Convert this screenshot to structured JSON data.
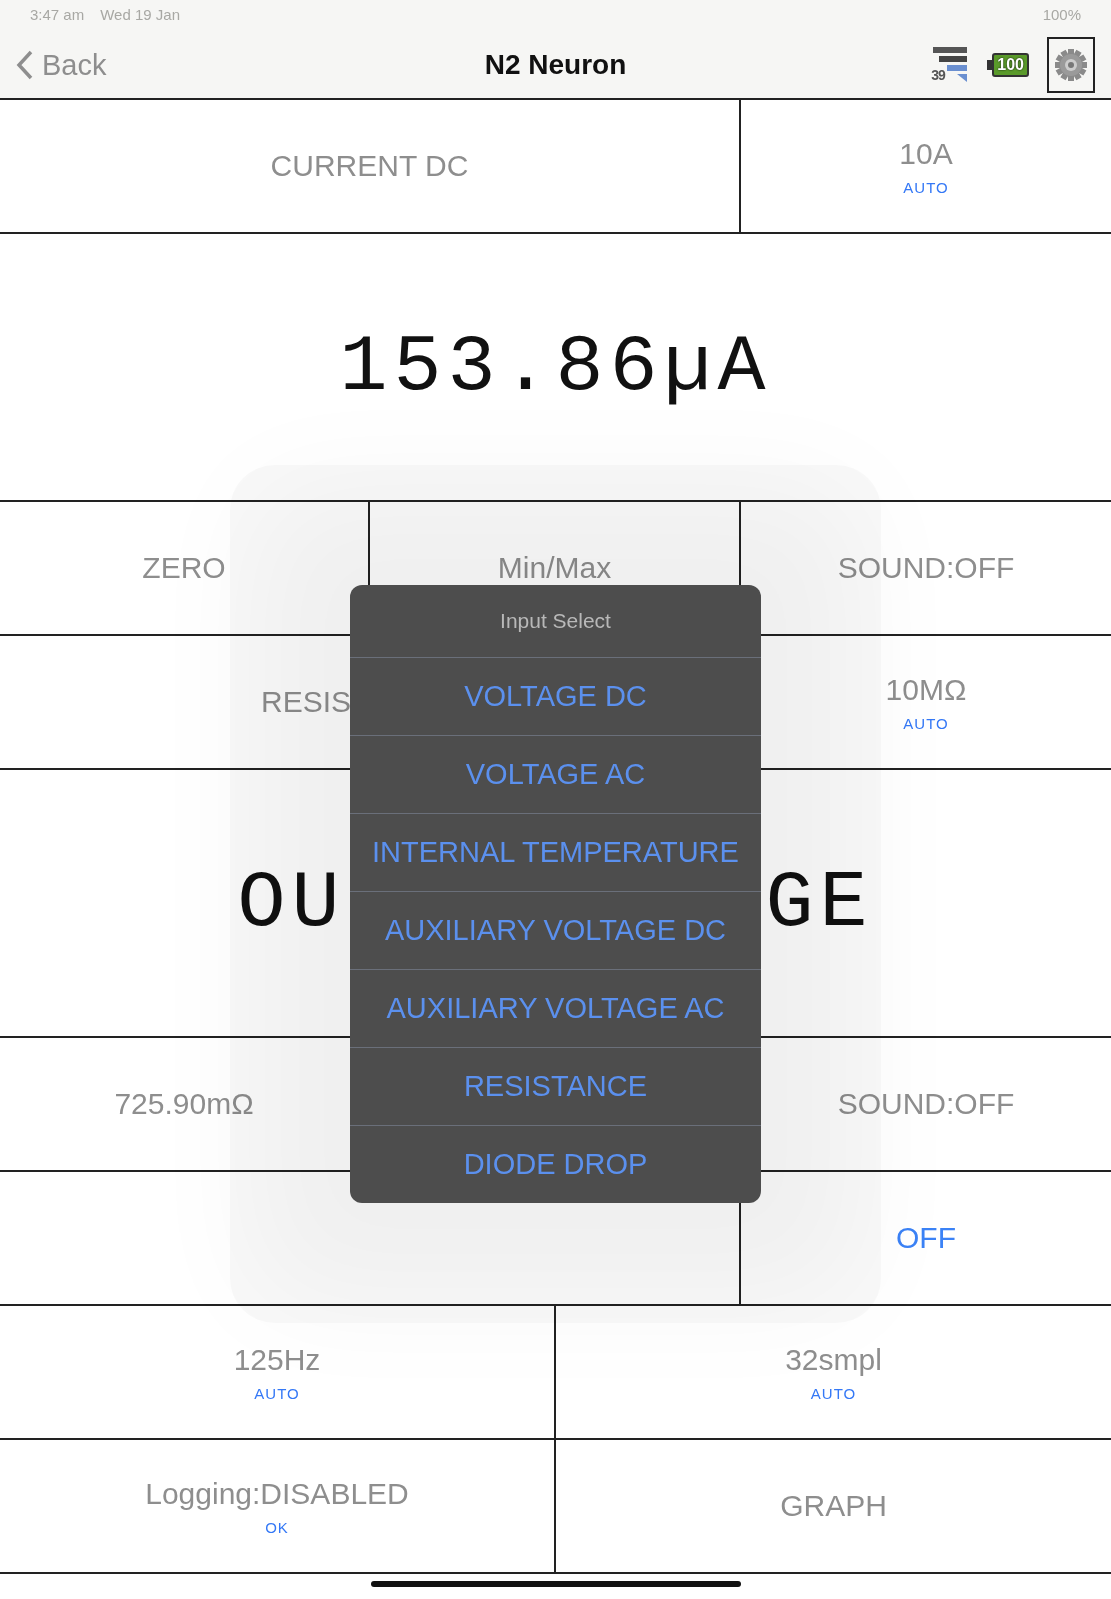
{
  "status_bar": {
    "time": "3:47 am",
    "date": "Wed 19 Jan",
    "battery": "100%"
  },
  "nav": {
    "back": "Back",
    "title": "N2 Neuron",
    "signal_reading": "39",
    "battery_reading": "100"
  },
  "rows": [
    {
      "kind": "wide",
      "cells": [
        {
          "text": "CURRENT DC"
        },
        {
          "text": "10A",
          "sub": "AUTO"
        }
      ]
    },
    {
      "kind": "display",
      "parts": [
        "153.86µA"
      ]
    },
    {
      "kind": "thirds",
      "cells": [
        {
          "text": "ZERO"
        },
        {
          "text": "Min/Max"
        },
        {
          "text": "SOUND:OFF"
        }
      ]
    },
    {
      "kind": "wide",
      "cells": [
        {
          "text": "RESIS",
          "covered": true
        },
        {
          "text": "10MΩ",
          "sub": "AUTO"
        }
      ]
    },
    {
      "kind": "display",
      "parts": [
        "OU",
        "GE"
      ]
    },
    {
      "kind": "thirds",
      "cells": [
        {
          "text": "725.90mΩ"
        },
        {},
        {
          "text": "SOUND:OFF"
        }
      ]
    },
    {
      "kind": "wide",
      "cells": [
        {},
        {
          "text": "OFF",
          "link": true
        }
      ]
    },
    {
      "kind": "halves",
      "cells": [
        {
          "text": "125Hz",
          "sub": "AUTO"
        },
        {
          "text": "32smpl",
          "sub": "AUTO"
        }
      ]
    },
    {
      "kind": "halves",
      "cells": [
        {
          "text": "Logging:DISABLED",
          "sub": "OK"
        },
        {
          "text": "GRAPH"
        }
      ]
    }
  ],
  "popup": {
    "title": "Input Select",
    "items": [
      "VOLTAGE DC",
      "VOLTAGE AC",
      "INTERNAL TEMPERATURE",
      "AUXILIARY VOLTAGE DC",
      "AUXILIARY VOLTAGE AC",
      "RESISTANCE",
      "DIODE DROP"
    ]
  }
}
